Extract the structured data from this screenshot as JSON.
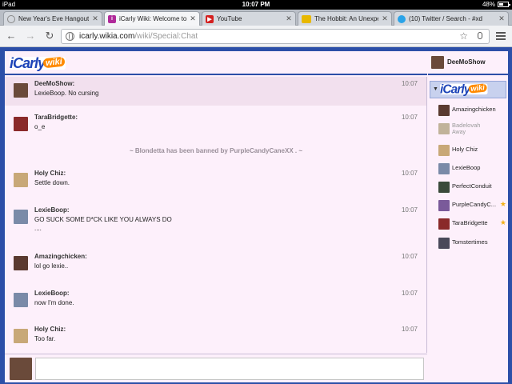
{
  "status_bar": {
    "device": "iPad",
    "time": "10:07 PM",
    "battery": "48%",
    "battery_level": 0.48
  },
  "tabs": [
    {
      "title": "New Year's Eve Hangout",
      "favicon": "globe-icon",
      "active": false
    },
    {
      "title": "iCarly Wiki: Welcome to t",
      "favicon": "icarly-wiki-icon",
      "active": true
    },
    {
      "title": "YouTube",
      "favicon": "youtube-icon",
      "active": false
    },
    {
      "title": "The Hobbit: An Unexpect",
      "favicon": "imdb-icon",
      "active": false
    },
    {
      "title": "(10) Twitter / Search - #xd",
      "favicon": "twitter-icon",
      "active": false
    }
  ],
  "address_bar": {
    "host": "icarly.wikia.com",
    "path": "/wiki/Special:Chat"
  },
  "wiki": {
    "logo_text": "iCarly",
    "logo_badge": "wiki"
  },
  "messages": [
    {
      "user": "DeeMoShow:",
      "text": "LexieBoop. No cursing",
      "time": "10:07",
      "avatar": "#6a4a3a"
    },
    {
      "user": "TaraBridgette:",
      "text": "o_e",
      "time": "10:07",
      "avatar": "#8a2a2a"
    },
    {
      "user": "Holy Chiz:",
      "text": "Settle down.",
      "time": "10:07",
      "avatar": "#c8a878"
    },
    {
      "user": "LexieBoop:",
      "text": "GO SUCK SOME D*CK LIKE YOU ALWAYS DO\n....",
      "time": "10:07",
      "avatar": "#7a8aa8"
    },
    {
      "user": "Amazingchicken:",
      "text": "lol go lexie..",
      "time": "10:07",
      "avatar": "#5a3a30"
    },
    {
      "user": "LexieBoop:",
      "text": "now I'm done.",
      "time": "10:07",
      "avatar": "#7a8aa8"
    },
    {
      "user": "Holy Chiz:",
      "text": "Too far.",
      "time": "10:07",
      "avatar": "#c8a878"
    }
  ],
  "inline_alert": "~ Blondetta has been banned by PurpleCandyCaneXX . ~",
  "current_user": {
    "name": "DeeMoShow",
    "avatar": "#6a4a3a"
  },
  "users": [
    {
      "name": "Amazingchicken",
      "status": "",
      "away": false,
      "star": false,
      "avatar": "#5a3a30"
    },
    {
      "name": "Badelovah",
      "status": "Away",
      "away": true,
      "star": false,
      "avatar": "#9a8a5a"
    },
    {
      "name": "Holy Chiz",
      "status": "",
      "away": false,
      "star": false,
      "avatar": "#c8a878"
    },
    {
      "name": "LexieBoop",
      "status": "",
      "away": false,
      "star": false,
      "avatar": "#7a8aa8"
    },
    {
      "name": "PerfectConduit",
      "status": "",
      "away": false,
      "star": false,
      "avatar": "#3a4a3a"
    },
    {
      "name": "PurpleCandyC...",
      "status": "",
      "away": false,
      "star": true,
      "avatar": "#7a5a9a"
    },
    {
      "name": "TaraBridgette",
      "status": "",
      "away": false,
      "star": true,
      "avatar": "#8a2a2a"
    },
    {
      "name": "Tomstertimes",
      "status": "",
      "away": false,
      "star": false,
      "avatar": "#4a4a5a"
    }
  ],
  "colors": {
    "page_bg": "#2c4fa8",
    "chat_bg": "#fdf0fb",
    "highlight": "#f2e0ee",
    "star": "#f2b21a"
  }
}
